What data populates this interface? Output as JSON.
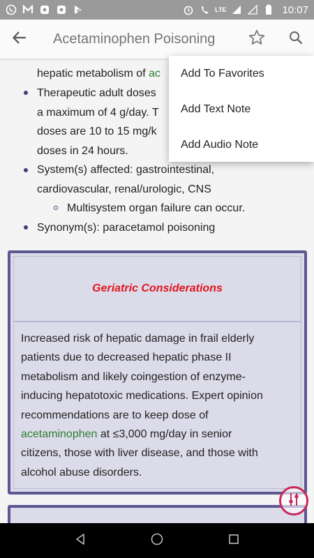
{
  "status_bar": {
    "lte_label": "LTE",
    "lte2_label": "LTE",
    "time": "10:07"
  },
  "app_bar": {
    "title": "Acetaminophen Poisoning"
  },
  "content": {
    "line1_prefix": "hepatic metabolism of ",
    "line1_green": "ac",
    "line2": "Therapeutic adult doses",
    "line3": "a maximum of 4 g/day. T",
    "line4": "doses are 10 to 15 mg/k",
    "line5": "doses in 24 hours.",
    "systems_line1": "System(s) affected: gastrointestinal,",
    "systems_line2": "cardiovascular, renal/urologic, CNS",
    "multisystem": "Multisystem organ failure can occur.",
    "synonyms": "Synonym(s): paracetamol poisoning"
  },
  "geriatric": {
    "title": "Geriatric Considerations",
    "body_line1": "Increased risk of hepatic damage in frail elderly",
    "body_line2": "patients due to decreased hepatic phase II",
    "body_line3": "metabolism and likely coingestion of enzyme-",
    "body_line4": "inducing hepatotoxic medications. Expert opinion",
    "body_line5": "recommendations are to keep dose of",
    "body_green": "acetaminophen",
    "body_line6_rest": " at ≤3,000 mg/day in senior",
    "body_line7": "citizens, those with liver disease, and those with",
    "body_line8": "alcohol abuse disorders."
  },
  "menu": {
    "items": [
      {
        "label": "Add To Favorites"
      },
      {
        "label": "Add Text Note"
      },
      {
        "label": "Add Audio Note"
      }
    ]
  },
  "colors": {
    "accent": "#5c5890",
    "title_red": "#e0141c",
    "link_green": "#2e7d32",
    "fab": "#c8285a"
  }
}
